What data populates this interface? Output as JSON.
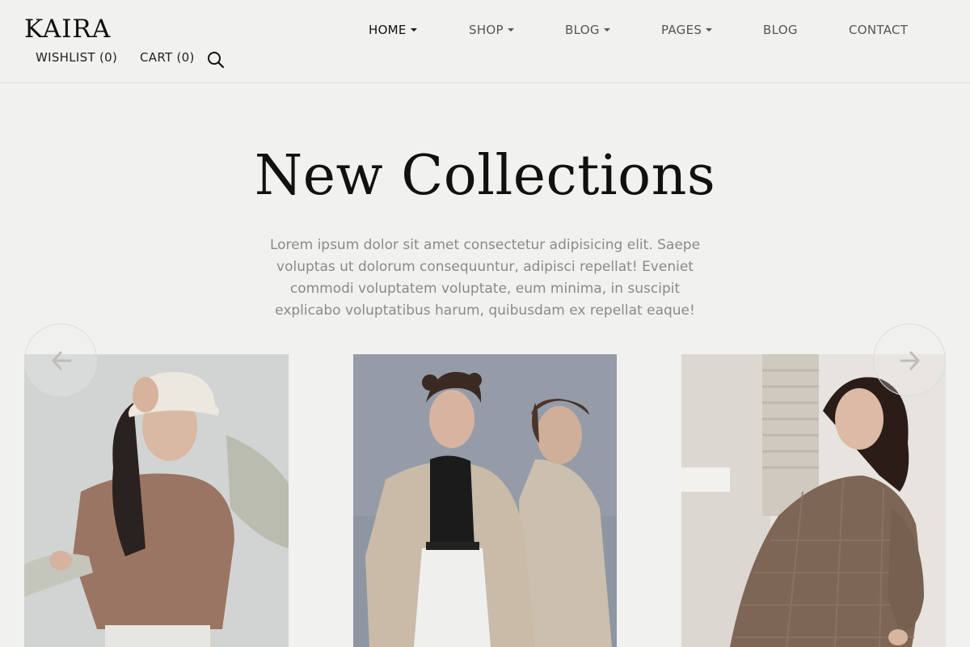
{
  "brand": {
    "logo": "KAIRA"
  },
  "nav": {
    "items": [
      {
        "label": "HOME",
        "dropdown": true,
        "active": true
      },
      {
        "label": "SHOP",
        "dropdown": true,
        "active": false
      },
      {
        "label": "BLOG",
        "dropdown": true,
        "active": false
      },
      {
        "label": "PAGES",
        "dropdown": true,
        "active": false
      },
      {
        "label": "BLOG",
        "dropdown": false,
        "active": false
      },
      {
        "label": "CONTACT",
        "dropdown": false,
        "active": false
      }
    ]
  },
  "utility": {
    "wishlist": "WISHLIST (0)",
    "cart": "CART (0)",
    "search_icon": "search-icon"
  },
  "hero": {
    "title": "New Collections",
    "description": "Lorem ipsum dolor sit amet consectetur adipisicing elit. Saepe voluptas ut dolorum consequuntur, adipisci repellat! Eveniet commodi voluptatem voluptate, eum minima, in suscipit explicabo voluptatibus harum, quibusdam ex repellat eaque!"
  },
  "carousel": {
    "prev_icon": "arrow-left-icon",
    "next_icon": "arrow-right-icon",
    "cards": [
      {
        "subject": "woman in bucket hat and brown top"
      },
      {
        "subject": "two models in beige trench coats"
      },
      {
        "subject": "woman in plaid blazer leaning on wall"
      }
    ]
  },
  "colors": {
    "background": "#f1f1ef",
    "text": "#111111",
    "muted": "#8a8a86",
    "border": "#dcdcd8"
  }
}
